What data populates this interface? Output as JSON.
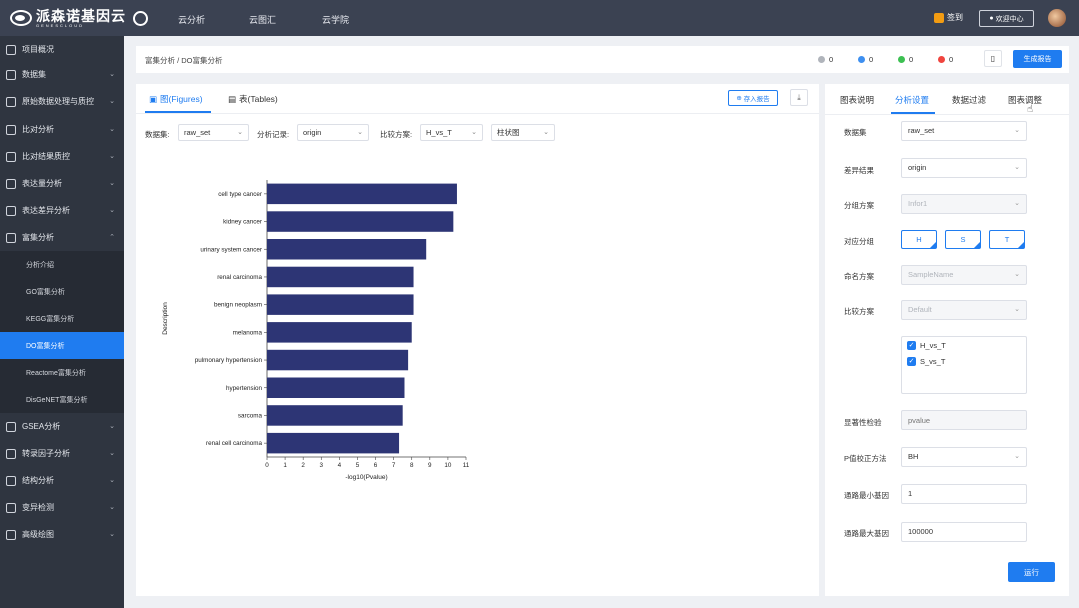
{
  "app": {
    "logo_main": "派森诺基因云",
    "logo_sub": "GENESCLOUD",
    "nav": [
      "云分析",
      "云图汇",
      "云学院"
    ],
    "signin": "签到",
    "user_center": "欢迎中心"
  },
  "sidebar": {
    "items": [
      {
        "label": "项目概况",
        "icon": "project-icon",
        "chevron": ""
      },
      {
        "label": "数据集",
        "icon": "dataset-icon",
        "chevron": "⌄"
      },
      {
        "label": "原始数据处理与质控",
        "icon": "qc-icon",
        "chevron": "⌄"
      },
      {
        "label": "比对分析",
        "icon": "align-icon",
        "chevron": "⌄"
      },
      {
        "label": "比对结果质控",
        "icon": "align-qc-icon",
        "chevron": "⌄"
      },
      {
        "label": "表达量分析",
        "icon": "expression-icon",
        "chevron": "⌄"
      },
      {
        "label": "表达差异分析",
        "icon": "diff-icon",
        "chevron": "⌄"
      },
      {
        "label": "富集分析",
        "icon": "enrich-icon",
        "chevron": "⌃"
      }
    ],
    "subitems": [
      "分析介绍",
      "GO富集分析",
      "KEGG富集分析",
      "DO富集分析",
      "Reactome富集分析",
      "DisGeNET富集分析"
    ],
    "items_after": [
      {
        "label": "GSEA分析",
        "icon": "gsea-icon",
        "chevron": "⌄"
      },
      {
        "label": "转录因子分析",
        "icon": "tf-icon",
        "chevron": "⌄"
      },
      {
        "label": "结构分析",
        "icon": "structure-icon",
        "chevron": "⌄"
      },
      {
        "label": "变异检测",
        "icon": "variant-icon",
        "chevron": "⌄"
      },
      {
        "label": "高级绘图",
        "icon": "plot-icon",
        "chevron": "⌄"
      }
    ]
  },
  "breadcrumb": "富集分析 / DO富集分析",
  "status": [
    {
      "color": "#b0b4bb",
      "count": "0"
    },
    {
      "color": "#3d8ff0",
      "count": "0"
    },
    {
      "color": "#3cc052",
      "count": "0"
    },
    {
      "color": "#f0443e",
      "count": "0"
    }
  ],
  "generate_report": "生成报告",
  "main": {
    "tabs": [
      "图(Figures)",
      "表(Tables)"
    ],
    "add_report": "存入报告",
    "filters": {
      "dataset_label": "数据集:",
      "dataset_value": "raw_set",
      "record_label": "分析记录:",
      "record_value": "origin",
      "compare_label": "比较方案:",
      "compare_value": "H_vs_T",
      "chart_type": "柱状图"
    }
  },
  "chart_data": {
    "type": "bar",
    "orientation": "horizontal",
    "categories": [
      "cell type cancer",
      "kidney cancer",
      "urinary system cancer",
      "renal carcinoma",
      "benign neoplasm",
      "melanoma",
      "pulmonary hypertension",
      "hypertension",
      "sarcoma",
      "renal cell carcinoma"
    ],
    "values": [
      10.5,
      10.3,
      8.8,
      8.1,
      8.1,
      8.0,
      7.8,
      7.6,
      7.5,
      7.3
    ],
    "xlabel": "-log10(Pvalue)",
    "ylabel": "Description",
    "xlim": [
      0,
      11
    ],
    "xticks": [
      "0",
      "1",
      "2",
      "3",
      "4",
      "5",
      "6",
      "7",
      "8",
      "9",
      "10",
      "11"
    ],
    "bar_color": "#2d3575"
  },
  "right": {
    "tabs": [
      "图表说明",
      "分析设置",
      "数据过滤",
      "图表调整"
    ],
    "fields": {
      "dataset_label": "数据集",
      "dataset_value": "raw_set",
      "diff_label": "差异结果",
      "diff_value": "origin",
      "group_scheme_label": "分组方案",
      "group_scheme_value": "Infor1",
      "group_label": "对应分组",
      "groups": [
        "H",
        "S",
        "T"
      ],
      "naming_label": "命名方案",
      "naming_value": "SampleName",
      "compare_label": "比较方案",
      "compare_value": "Default",
      "compare_options": [
        "H_vs_T",
        "S_vs_T"
      ],
      "sig_label": "显著性检验",
      "sig_placeholder": "pvalue",
      "padj_label": "P值校正方法",
      "padj_value": "BH",
      "min_label": "通路最小基因",
      "min_value": "1",
      "max_label": "通路最大基因",
      "max_value": "100000"
    },
    "run": "运行"
  }
}
